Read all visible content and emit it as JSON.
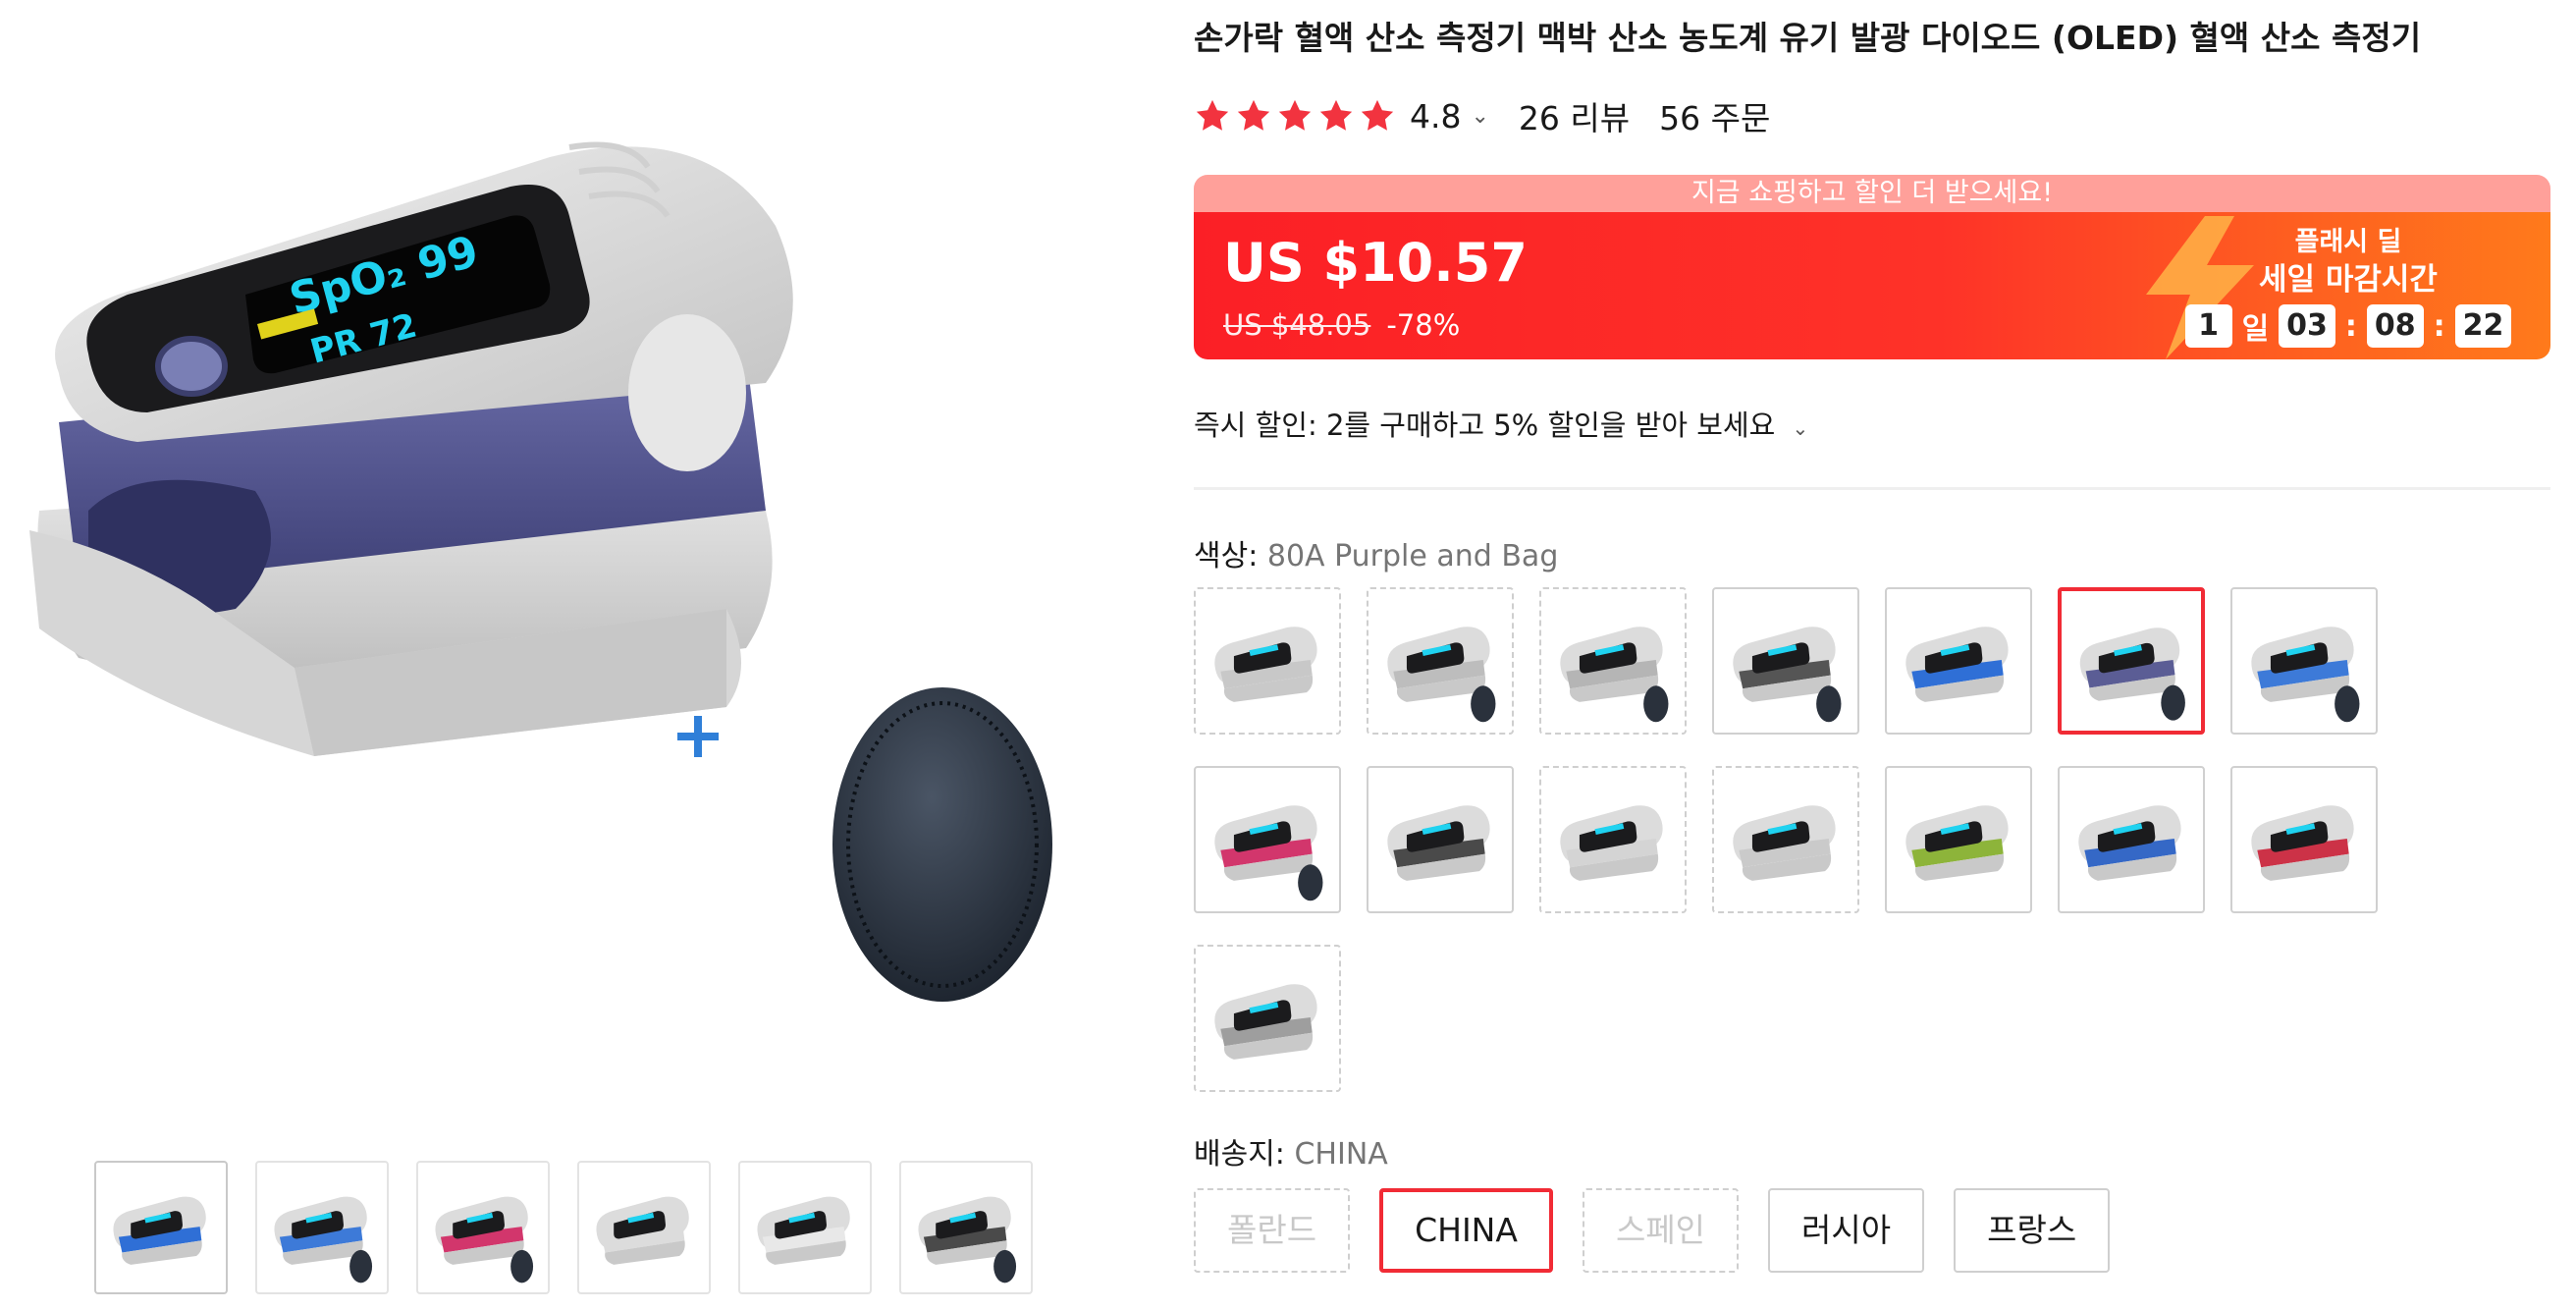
{
  "product": {
    "title": "손가락 혈액 산소 측정기 맥박 산소 농도계 유기 발광 다이오드 (OLED) 혈액 산소 측정기",
    "rating": "4.8",
    "reviews": "26 리뷰",
    "orders": "56 주문",
    "stars": 5
  },
  "gallery": {
    "main_image": "pulse-oximeter-purple-with-case",
    "thumbnails": [
      "oximeter-blue-front",
      "oximeter-blue-with-case",
      "oximeter-pink-with-case",
      "oximeter-spec-sheet",
      "oximeter-weight-info",
      "oximeter-black-with-case"
    ]
  },
  "price": {
    "promo_text": "지금 쇼핑하고 할인 더 받으세요!",
    "current": "US $10.57",
    "original": "US $48.05",
    "discount": "-78%",
    "flash_title": "플래시 딜",
    "flash_subtitle": "세일 마감시간",
    "countdown": {
      "days": "1",
      "day_unit": "일",
      "hours": "03",
      "minutes": "08",
      "seconds": "22"
    }
  },
  "instant_discount": {
    "label": "즉시 할인:",
    "text": "2를 구매하고 5% 할인을 받아 보세요"
  },
  "color": {
    "label": "색상:",
    "value": "80A Purple and Bag",
    "options": [
      {
        "name": "white-gray-tilted",
        "accent": "#c8c8c8",
        "dashed": true,
        "selected": false
      },
      {
        "name": "white-with-case",
        "accent": "#bdbdbd",
        "dashed": true,
        "selected": false
      },
      {
        "name": "white-gray-with-case",
        "accent": "#b5b5b5",
        "dashed": true,
        "selected": false
      },
      {
        "name": "black-with-case",
        "accent": "#555555",
        "dashed": false,
        "selected": false
      },
      {
        "name": "blue-front",
        "accent": "#2f6fd6",
        "dashed": false,
        "selected": false
      },
      {
        "name": "purple-and-bag",
        "accent": "#5b5d95",
        "dashed": false,
        "selected": true
      },
      {
        "name": "blue-with-case",
        "accent": "#3d7ad8",
        "dashed": false,
        "selected": false
      },
      {
        "name": "pink-with-case",
        "accent": "#d2366c",
        "dashed": false,
        "selected": false
      },
      {
        "name": "black-gray",
        "accent": "#4a4a4a",
        "dashed": false,
        "selected": false
      },
      {
        "name": "white-upright",
        "accent": "#d4d4d4",
        "dashed": true,
        "selected": false
      },
      {
        "name": "white-upright-2",
        "accent": "#cacaca",
        "dashed": true,
        "selected": false
      },
      {
        "name": "green",
        "accent": "#8db43a",
        "dashed": false,
        "selected": false
      },
      {
        "name": "blue",
        "accent": "#3568c6",
        "dashed": false,
        "selected": false
      },
      {
        "name": "red",
        "accent": "#cc3247",
        "dashed": false,
        "selected": false
      },
      {
        "name": "gray-tilted",
        "accent": "#9e9e9e",
        "dashed": true,
        "selected": false
      }
    ]
  },
  "shipping": {
    "label": "배송지:",
    "value": "CHINA",
    "options": [
      {
        "label": "폴란드",
        "state": "disabled"
      },
      {
        "label": "CHINA",
        "state": "selected"
      },
      {
        "label": "스페인",
        "state": "disabled"
      },
      {
        "label": "러시아",
        "state": "normal"
      },
      {
        "label": "프랑스",
        "state": "normal"
      }
    ]
  },
  "colors": {
    "accent_red": "#f12b35",
    "star": "#f2333f",
    "plus_blue": "#2f7fd8"
  }
}
